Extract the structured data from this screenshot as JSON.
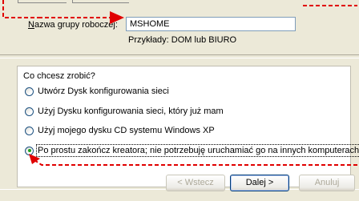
{
  "workgroup": {
    "label_prefix": "N",
    "label_rest": "azwa grupy roboczej:",
    "value": "MSHOME",
    "example": "Przykłady: DOM lub BIURO"
  },
  "choice": {
    "question": "Co chcesz zrobić?",
    "options": [
      {
        "label": "Utwórz Dysk konfigurowania sieci",
        "checked": false
      },
      {
        "label": "Użyj Dysku konfigurowania sieci, który już mam",
        "checked": false
      },
      {
        "label": "Użyj mojego dysku CD systemu Windows XP",
        "checked": false
      },
      {
        "label": "Po prostu zakończ kreatora; nie potrzebuję uruchamiać go na innych komputerach",
        "checked": true
      }
    ]
  },
  "buttons": {
    "back": "< Wstecz",
    "next": "Dalej >",
    "cancel": "Anuluj"
  },
  "colors": {
    "annotation_arrow": "#e00000",
    "window_bg": "#ece9d8",
    "input_border": "#7f9db9"
  }
}
